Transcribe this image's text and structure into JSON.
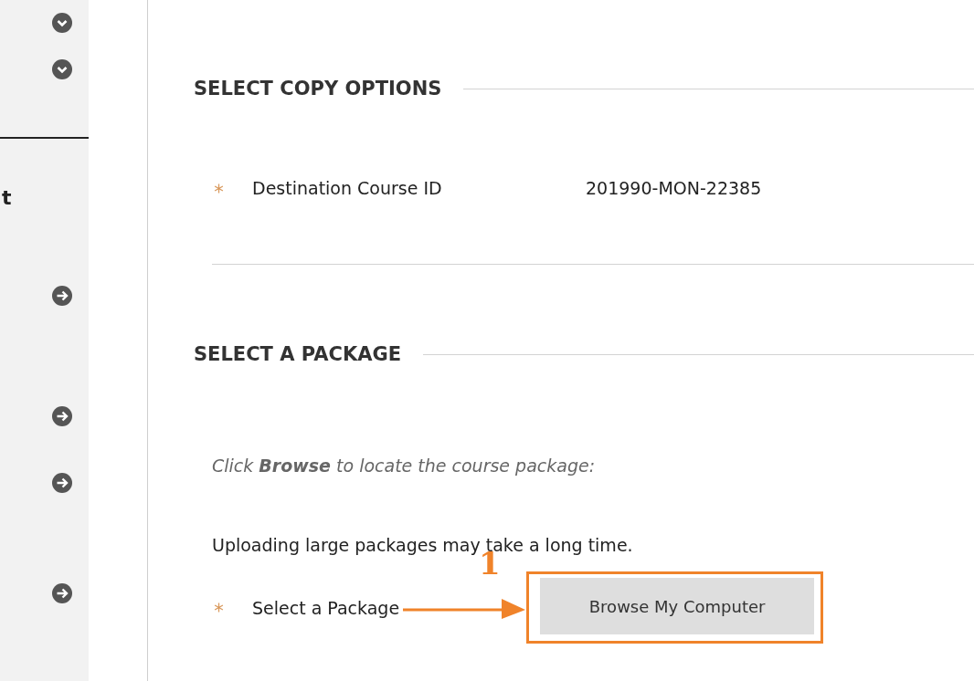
{
  "sidebar": {
    "items": [
      {
        "kind": "expand"
      },
      {
        "kind": "expand"
      },
      {
        "kind": "divider"
      },
      {
        "kind": "label",
        "text": "t"
      },
      {
        "kind": "arrow"
      },
      {
        "kind": "arrow"
      },
      {
        "kind": "arrow"
      },
      {
        "kind": "arrow"
      }
    ]
  },
  "sections": [
    {
      "heading": "SELECT COPY OPTIONS",
      "fields": [
        {
          "kind": "text",
          "required": true,
          "label": "Destination Course ID",
          "value": "201990-MON-22385"
        }
      ]
    },
    {
      "heading": "SELECT A PACKAGE",
      "instruction": "Click **Browse** to locate the course package:",
      "note": "Uploading large packages may take a long time.",
      "fields": [
        {
          "kind": "button",
          "required": true,
          "label": "Select a Package",
          "button": "Browse My Computer",
          "annotation": "1"
        }
      ]
    }
  ]
}
